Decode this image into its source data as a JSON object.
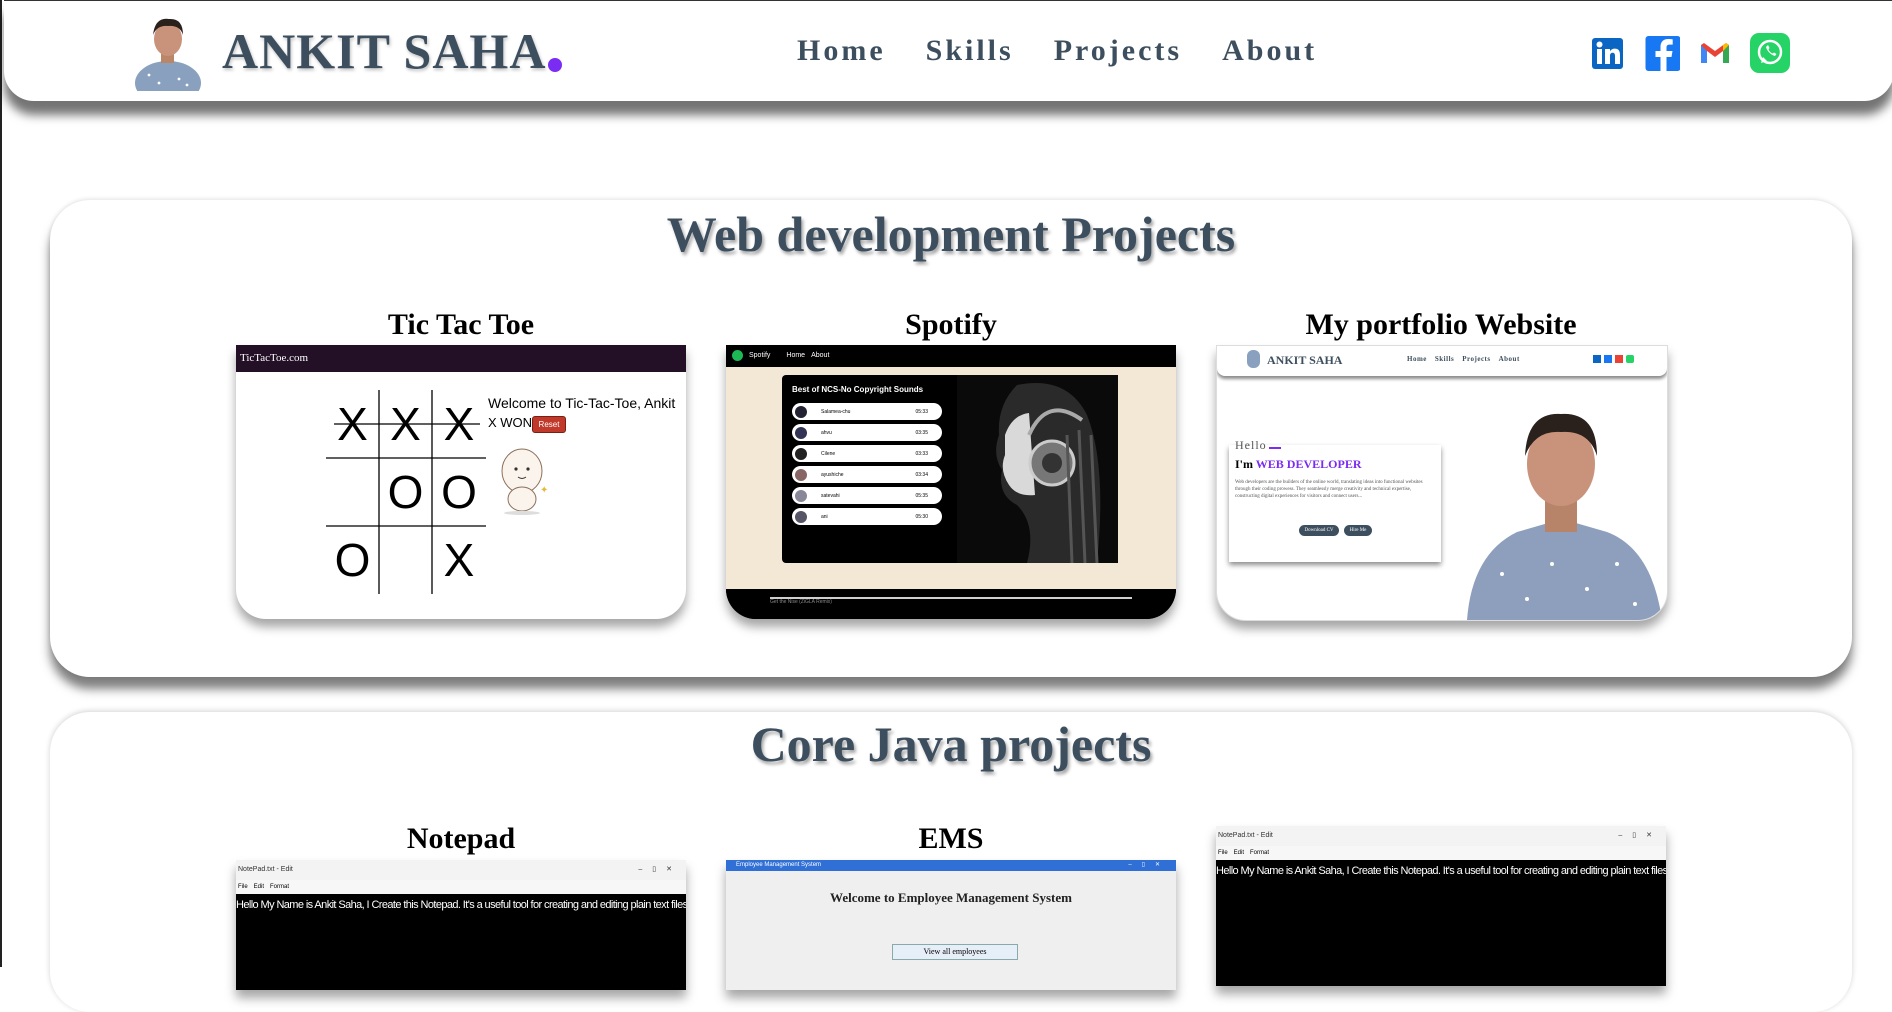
{
  "header": {
    "brand": "ANKIT SAHA",
    "nav": [
      "Home",
      "Skills",
      "Projects",
      "About"
    ],
    "socials": [
      "linkedin-icon",
      "facebook-icon",
      "gmail-icon",
      "whatsapp-icon"
    ]
  },
  "web_section": {
    "title": "Web development Projects",
    "cards": [
      {
        "title": "Tic Tac Toe",
        "preview": {
          "site_title": "TicTacToe.com",
          "welcome": "Welcome to Tic-Tac-Toe, Ankit",
          "status": "X WON",
          "reset": "Reset",
          "board": [
            "X",
            "X",
            "X",
            "",
            "O",
            "O",
            "O",
            "",
            "X"
          ]
        }
      },
      {
        "title": "Spotify",
        "preview": {
          "brand": "Spotify",
          "nav": [
            "Home",
            "About"
          ],
          "playlist_title": "Best of NCS-No Copyright Sounds",
          "songs": [
            {
              "name": "Salamea-chu",
              "time": "05:33"
            },
            {
              "name": "ahvu",
              "time": "03:35"
            },
            {
              "name": "Cilene",
              "time": "03:33"
            },
            {
              "name": "ayushiche",
              "time": "03:34"
            },
            {
              "name": "satevahi",
              "time": "05:35"
            },
            {
              "name": "ani",
              "time": "05:30"
            }
          ],
          "footer_song": "Get the Nise (ZiGLA Remix)"
        }
      },
      {
        "title": "My portfolio Website",
        "preview": {
          "brand": "ANKIT SAHA",
          "nav": [
            "Home",
            "Skills",
            "Projects",
            "About"
          ],
          "hello": "Hello",
          "im": "I'm",
          "role": "WEB DEVELOPER",
          "desc": "Web developers are the builders of the online world, translating ideas into functional websites through their coding prowess. They seamlessly merge creativity and technical expertise, constructing digital experiences for visitors and connect users...",
          "buttons": [
            "Download CV",
            "Hire Me"
          ]
        }
      }
    ]
  },
  "java_section": {
    "title": "Core Java projects",
    "cards": [
      {
        "title": "Notepad",
        "preview": {
          "window_title": "NotePad.txt - Edit",
          "menu": [
            "File",
            "Edit",
            "Format"
          ],
          "text": "Hello My Name is Ankit Saha, I Create this Notepad. It's a useful tool for creating and editing plain text files, writing code, and automating repetitive tasks."
        }
      },
      {
        "title": "EMS",
        "preview": {
          "window_title": "Employee Management System",
          "welcome": "Welcome to Employee Management System",
          "button": "View all employees"
        }
      },
      {
        "title": "",
        "preview": {
          "window_title": "NotePad.txt - Edit",
          "menu": [
            "File",
            "Edit",
            "Format"
          ],
          "text": "Hello My Name is Ankit Saha, I Create this Notepad. It's a useful tool for creating and editing plain text files, writing code, and automating repetitive tasks."
        }
      }
    ]
  }
}
